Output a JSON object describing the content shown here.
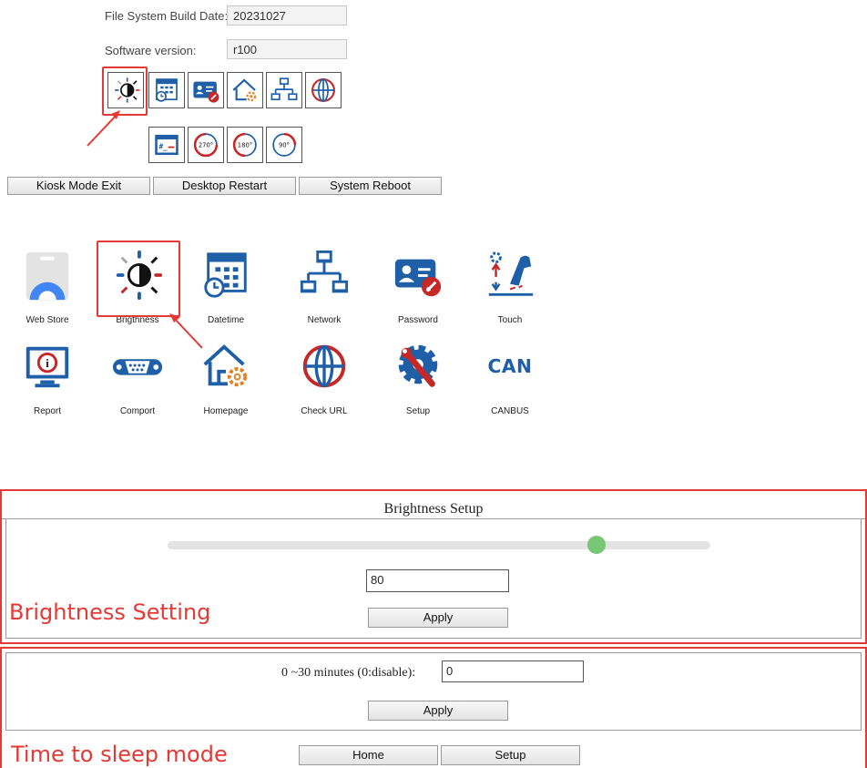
{
  "info": {
    "build_date_label": "File System Build Date:",
    "build_date_value": "20231027",
    "software_label": "Software version:",
    "software_value": "r100"
  },
  "toolbar_icons": [
    "brightness-icon",
    "datetime-icon",
    "password-icon",
    "homepage-icon",
    "network-icon",
    "check-url-icon",
    "terminal-icon",
    "rotate-270-icon",
    "rotate-180-icon",
    "rotate-90-icon"
  ],
  "rotate_labels": [
    "270°",
    "180°",
    "90°"
  ],
  "system_buttons": {
    "kiosk_exit": "Kiosk Mode Exit",
    "desktop_restart": "Desktop Restart",
    "system_reboot": "System Reboot"
  },
  "apps": [
    {
      "label": "Web Store",
      "icon": "web-store-icon"
    },
    {
      "label": "Brigthness",
      "icon": "brightness-icon"
    },
    {
      "label": "Datetime",
      "icon": "datetime-icon"
    },
    {
      "label": "Network",
      "icon": "network-icon"
    },
    {
      "label": "Password",
      "icon": "password-icon"
    },
    {
      "label": "Touch",
      "icon": "touch-icon"
    },
    {
      "label": "Report",
      "icon": "report-icon"
    },
    {
      "label": "Comport",
      "icon": "comport-icon"
    },
    {
      "label": "Homepage",
      "icon": "homepage-icon"
    },
    {
      "label": "Check URL",
      "icon": "check-url-icon"
    },
    {
      "label": "Setup",
      "icon": "setup-icon"
    },
    {
      "label": "CANBUS",
      "icon": "canbus-icon",
      "glyph": "CAN"
    }
  ],
  "brightness": {
    "title": "Brightness Setup",
    "slider_level": 0.79,
    "value": "80",
    "apply_label": "Apply",
    "note": "Brightness Setting"
  },
  "sleep": {
    "label": "0 ~30 minutes (0:disable):",
    "value": "0",
    "apply_label": "Apply",
    "home_label": "Home",
    "setup_label": "Setup",
    "note": "Time to sleep mode"
  },
  "colors": {
    "accent_red": "#e53935",
    "icon_blue": "#1f5fa8",
    "slider_knob": "#77c777"
  }
}
